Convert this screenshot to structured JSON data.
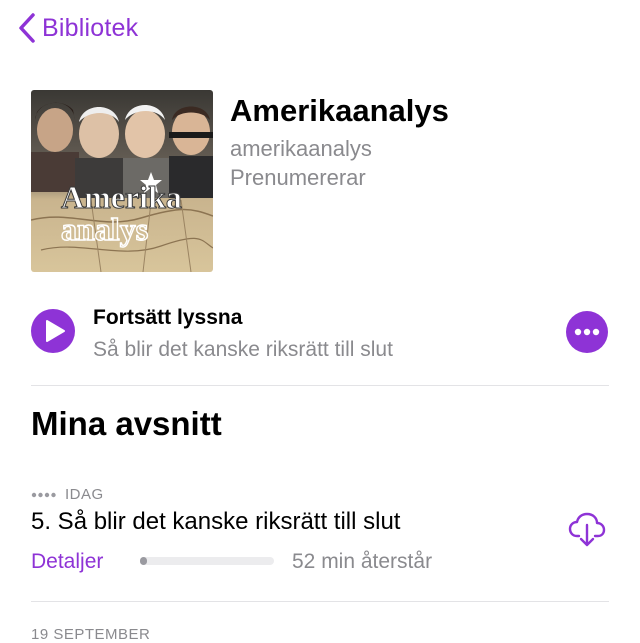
{
  "nav": {
    "back_label": "Bibliotek",
    "back_icon": "chevron-left-icon",
    "accent": "#8e33d6"
  },
  "podcast": {
    "artwork_text_top": "Amerika",
    "artwork_text_bottom": "analys",
    "title": "Amerikaanalys",
    "author": "amerikaanalys",
    "subscription_status": "Prenumererar"
  },
  "continue": {
    "label": "Fortsätt lyssna",
    "episode": "Så blir det kanske riksrätt till slut",
    "play_icon": "play-icon",
    "more_icon": "ellipsis-icon"
  },
  "section": {
    "title": "Mina avsnitt"
  },
  "episodes": [
    {
      "date_label": "IDAG",
      "title": "5. Så blir det kanske riksrätt till slut",
      "details_label": "Detaljer",
      "progress": 0.05,
      "remaining": "52 min återstår",
      "action_icon": "cloud-download-icon"
    }
  ],
  "next_date_label": "19 SEPTEMBER"
}
